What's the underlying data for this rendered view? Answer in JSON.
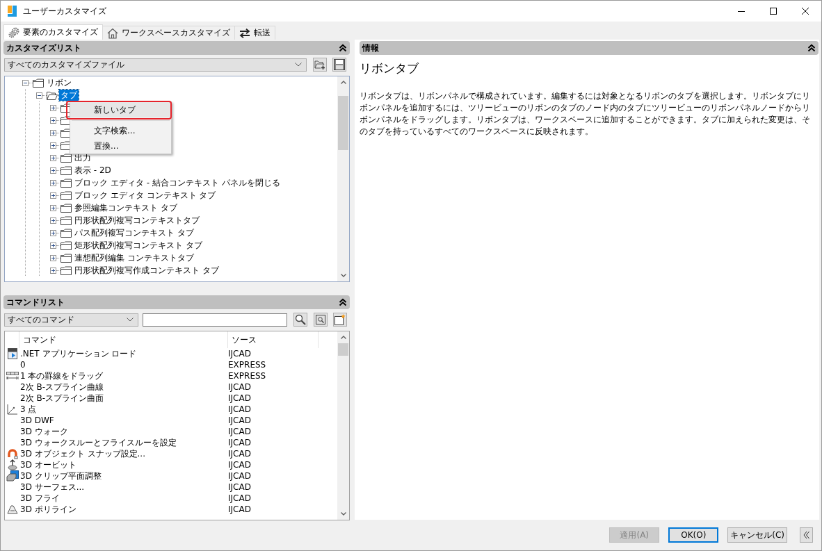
{
  "window": {
    "title": "ユーザーカスタマイズ"
  },
  "tabs": [
    {
      "label": "要素のカスタマイズ",
      "selected": true
    },
    {
      "label": "ワークスペースカスタマイズ",
      "selected": false
    },
    {
      "label": "転送",
      "selected": false
    }
  ],
  "customize_list": {
    "title": "カスタマイズリスト",
    "file_select": {
      "value": "すべてのカスタマイズファイル"
    },
    "tree": [
      {
        "label": "リボン",
        "expanded": true,
        "selected": false,
        "children": [
          {
            "label": "タブ",
            "expanded": true,
            "selected": true,
            "children": [
              {
                "expanded": false,
                "selected": false
              },
              {
                "expanded": false,
                "selected": false
              },
              {
                "expanded": false,
                "selected": false
              },
              {
                "expanded": false,
                "selected": false
              },
              {
                "label": "出力",
                "expanded": false,
                "selected": false
              },
              {
                "label": "表示 - 2D",
                "expanded": false,
                "selected": false
              },
              {
                "label": "ブロック エディタ - 結合コンテキスト パネルを閉じる",
                "expanded": false,
                "selected": false
              },
              {
                "label": "ブロック エディタ コンテキスト タブ",
                "expanded": false,
                "selected": false
              },
              {
                "label": "参照編集コンテキスト タブ",
                "expanded": false,
                "selected": false
              },
              {
                "label": "円形状配列複写コンテキストタブ",
                "expanded": false,
                "selected": false
              },
              {
                "label": "パス配列複写コンテキスト タブ",
                "expanded": false,
                "selected": false
              },
              {
                "label": "矩形状配列複写コンテキスト タブ",
                "expanded": false,
                "selected": false
              },
              {
                "label": "連想配列編集 コンテキストタブ",
                "expanded": false,
                "selected": false
              },
              {
                "label": "円形状配列複写作成コンテキスト タブ",
                "expanded": false,
                "selected": false
              }
            ]
          }
        ]
      }
    ]
  },
  "context_menu": {
    "items": [
      {
        "kind": "item",
        "label": "新しいタブ",
        "highlighted": true
      },
      {
        "kind": "separator"
      },
      {
        "kind": "item",
        "label": "文字検索...",
        "highlighted": false
      },
      {
        "kind": "item",
        "label": "置換...",
        "highlighted": false
      }
    ]
  },
  "command_list": {
    "title": "コマンドリスト",
    "filter_select": {
      "value": "すべてのコマンド"
    },
    "columns": [
      "コマンド",
      "ソース"
    ],
    "rows": [
      {
        "kind": "net",
        "command": ".NET アプリケーション ロード",
        "source": "IJCAD"
      },
      {
        "kind": "plain",
        "command": "0",
        "source": "EXPRESS"
      },
      {
        "kind": "table",
        "command": "1 本の罫線をドラッグ",
        "source": "EXPRESS"
      },
      {
        "kind": "plain",
        "command": "2次 B-スプライン曲線",
        "source": "IJCAD"
      },
      {
        "kind": "plain",
        "command": "2次 B-スプライン曲面",
        "source": "IJCAD"
      },
      {
        "kind": "axes",
        "command": "3 点",
        "source": "IJCAD"
      },
      {
        "kind": "plain",
        "command": "3D DWF",
        "source": "IJCAD"
      },
      {
        "kind": "plain",
        "command": "3D ウォーク",
        "source": "IJCAD"
      },
      {
        "kind": "plain",
        "command": "3D ウォークスルーとフライスルーを設定",
        "source": "IJCAD"
      },
      {
        "kind": "magnet",
        "command": "3D オブジェクト スナップ設定...",
        "source": "IJCAD"
      },
      {
        "kind": "orbit",
        "command": "3D オービット",
        "source": "IJCAD"
      },
      {
        "kind": "clip",
        "command": "3D クリップ平面調整",
        "source": "IJCAD"
      },
      {
        "kind": "plain",
        "command": "3D サーフェス...",
        "source": "IJCAD"
      },
      {
        "kind": "plain",
        "command": "3D フライ",
        "source": "IJCAD"
      },
      {
        "kind": "polyline",
        "command": "3D ポリライン",
        "source": "IJCAD"
      }
    ]
  },
  "info_panel": {
    "title": "情報",
    "heading": "リボンタブ",
    "description": "リボンタブは、リボンパネルで構成されています。編集するには対象となるリボンのタブを選択します。リボンタブにリボンパネルを追加するには、ツリービューのリボンのタブのノード内のタブにツリービューのリボンパネルノードからリボンパネルをドラッグします。リボンタブは、ワークスペースに追加することができます。タブに加えられた変更は、そのタブを持っているすべてのワークスペースに反映されます。"
  },
  "buttons": [
    {
      "label": "適用(A)",
      "disabled": true,
      "default": false
    },
    {
      "label": "OK(O)",
      "disabled": false,
      "default": true
    },
    {
      "label": "キャンセル(C)",
      "disabled": false,
      "default": false
    }
  ]
}
